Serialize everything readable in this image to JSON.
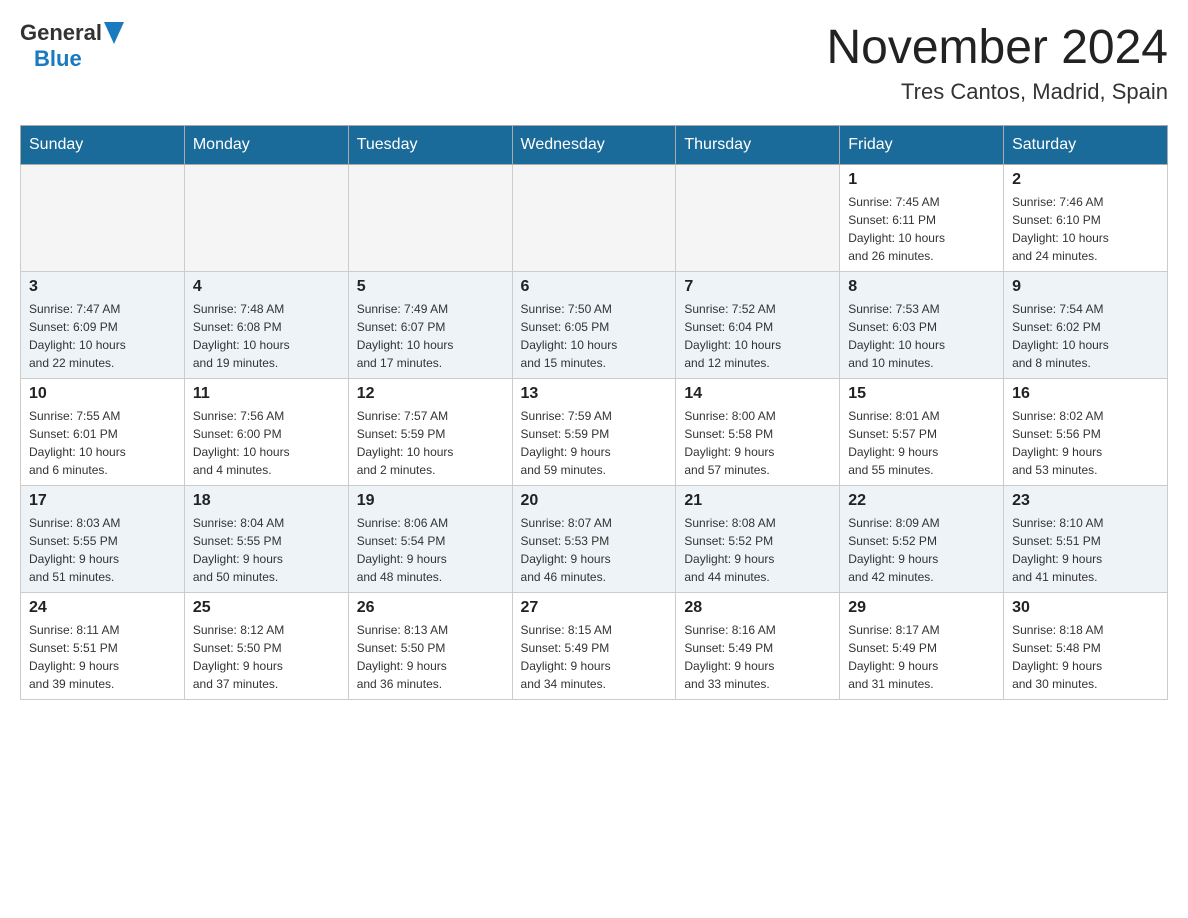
{
  "logo": {
    "general": "General",
    "blue": "Blue"
  },
  "title": "November 2024",
  "subtitle": "Tres Cantos, Madrid, Spain",
  "days_of_week": [
    "Sunday",
    "Monday",
    "Tuesday",
    "Wednesday",
    "Thursday",
    "Friday",
    "Saturday"
  ],
  "weeks": [
    [
      {
        "day": "",
        "info": ""
      },
      {
        "day": "",
        "info": ""
      },
      {
        "day": "",
        "info": ""
      },
      {
        "day": "",
        "info": ""
      },
      {
        "day": "",
        "info": ""
      },
      {
        "day": "1",
        "info": "Sunrise: 7:45 AM\nSunset: 6:11 PM\nDaylight: 10 hours\nand 26 minutes."
      },
      {
        "day": "2",
        "info": "Sunrise: 7:46 AM\nSunset: 6:10 PM\nDaylight: 10 hours\nand 24 minutes."
      }
    ],
    [
      {
        "day": "3",
        "info": "Sunrise: 7:47 AM\nSunset: 6:09 PM\nDaylight: 10 hours\nand 22 minutes."
      },
      {
        "day": "4",
        "info": "Sunrise: 7:48 AM\nSunset: 6:08 PM\nDaylight: 10 hours\nand 19 minutes."
      },
      {
        "day": "5",
        "info": "Sunrise: 7:49 AM\nSunset: 6:07 PM\nDaylight: 10 hours\nand 17 minutes."
      },
      {
        "day": "6",
        "info": "Sunrise: 7:50 AM\nSunset: 6:05 PM\nDaylight: 10 hours\nand 15 minutes."
      },
      {
        "day": "7",
        "info": "Sunrise: 7:52 AM\nSunset: 6:04 PM\nDaylight: 10 hours\nand 12 minutes."
      },
      {
        "day": "8",
        "info": "Sunrise: 7:53 AM\nSunset: 6:03 PM\nDaylight: 10 hours\nand 10 minutes."
      },
      {
        "day": "9",
        "info": "Sunrise: 7:54 AM\nSunset: 6:02 PM\nDaylight: 10 hours\nand 8 minutes."
      }
    ],
    [
      {
        "day": "10",
        "info": "Sunrise: 7:55 AM\nSunset: 6:01 PM\nDaylight: 10 hours\nand 6 minutes."
      },
      {
        "day": "11",
        "info": "Sunrise: 7:56 AM\nSunset: 6:00 PM\nDaylight: 10 hours\nand 4 minutes."
      },
      {
        "day": "12",
        "info": "Sunrise: 7:57 AM\nSunset: 5:59 PM\nDaylight: 10 hours\nand 2 minutes."
      },
      {
        "day": "13",
        "info": "Sunrise: 7:59 AM\nSunset: 5:59 PM\nDaylight: 9 hours\nand 59 minutes."
      },
      {
        "day": "14",
        "info": "Sunrise: 8:00 AM\nSunset: 5:58 PM\nDaylight: 9 hours\nand 57 minutes."
      },
      {
        "day": "15",
        "info": "Sunrise: 8:01 AM\nSunset: 5:57 PM\nDaylight: 9 hours\nand 55 minutes."
      },
      {
        "day": "16",
        "info": "Sunrise: 8:02 AM\nSunset: 5:56 PM\nDaylight: 9 hours\nand 53 minutes."
      }
    ],
    [
      {
        "day": "17",
        "info": "Sunrise: 8:03 AM\nSunset: 5:55 PM\nDaylight: 9 hours\nand 51 minutes."
      },
      {
        "day": "18",
        "info": "Sunrise: 8:04 AM\nSunset: 5:55 PM\nDaylight: 9 hours\nand 50 minutes."
      },
      {
        "day": "19",
        "info": "Sunrise: 8:06 AM\nSunset: 5:54 PM\nDaylight: 9 hours\nand 48 minutes."
      },
      {
        "day": "20",
        "info": "Sunrise: 8:07 AM\nSunset: 5:53 PM\nDaylight: 9 hours\nand 46 minutes."
      },
      {
        "day": "21",
        "info": "Sunrise: 8:08 AM\nSunset: 5:52 PM\nDaylight: 9 hours\nand 44 minutes."
      },
      {
        "day": "22",
        "info": "Sunrise: 8:09 AM\nSunset: 5:52 PM\nDaylight: 9 hours\nand 42 minutes."
      },
      {
        "day": "23",
        "info": "Sunrise: 8:10 AM\nSunset: 5:51 PM\nDaylight: 9 hours\nand 41 minutes."
      }
    ],
    [
      {
        "day": "24",
        "info": "Sunrise: 8:11 AM\nSunset: 5:51 PM\nDaylight: 9 hours\nand 39 minutes."
      },
      {
        "day": "25",
        "info": "Sunrise: 8:12 AM\nSunset: 5:50 PM\nDaylight: 9 hours\nand 37 minutes."
      },
      {
        "day": "26",
        "info": "Sunrise: 8:13 AM\nSunset: 5:50 PM\nDaylight: 9 hours\nand 36 minutes."
      },
      {
        "day": "27",
        "info": "Sunrise: 8:15 AM\nSunset: 5:49 PM\nDaylight: 9 hours\nand 34 minutes."
      },
      {
        "day": "28",
        "info": "Sunrise: 8:16 AM\nSunset: 5:49 PM\nDaylight: 9 hours\nand 33 minutes."
      },
      {
        "day": "29",
        "info": "Sunrise: 8:17 AM\nSunset: 5:49 PM\nDaylight: 9 hours\nand 31 minutes."
      },
      {
        "day": "30",
        "info": "Sunrise: 8:18 AM\nSunset: 5:48 PM\nDaylight: 9 hours\nand 30 minutes."
      }
    ]
  ]
}
